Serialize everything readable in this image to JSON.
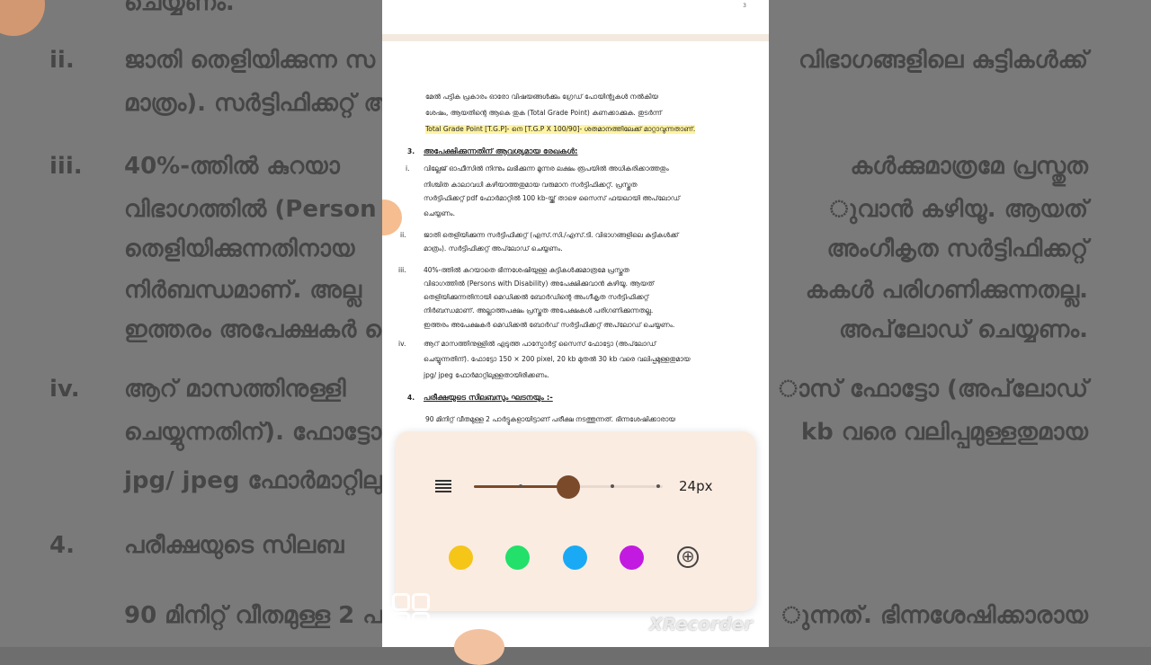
{
  "background": {
    "lines": [
      {
        "num": "ii.",
        "text": "ജാതി തെളിയിക്കുന്ന സ",
        "right": "വിഭാഗങ്ങളിലെ കുട്ടികൾക്ക്"
      },
      {
        "num": "",
        "text": "മാത്രം). സർട്ടിഫിക്കറ്റ് അ",
        "right": ""
      },
      {
        "num": "iii.",
        "text": "40%-ത്തിൽ കുറയാ",
        "right": "കൾക്കുമാത്രമേ പ്രസ്തുത"
      },
      {
        "num": "",
        "text": "വിഭാഗത്തിൽ (Person",
        "right": "ുവാൻ കഴിയൂ. ആയത്"
      },
      {
        "num": "",
        "text": "തെളിയിക്കുന്നതിനായ",
        "right": "അംഗീകൃത സർട്ടിഫിക്കറ്റ്"
      },
      {
        "num": "",
        "text": "നിർബന്ധമാണ്. അല്ല",
        "right": "കകൾ പരിഗണിക്കുന്നതല്ല."
      },
      {
        "num": "",
        "text": "ഇത്തരം അപേക്ഷകർ മെ",
        "right": "അപ്‌ലോഡ് ചെയ്യണം."
      },
      {
        "num": "iv.",
        "text": "ആറ് മാസത്തിനുള്ളി",
        "right": "ാസ് ഫോട്ടോ (അപ്‌ലോഡ്"
      },
      {
        "num": "",
        "text": "ചെയ്യുന്നതിന്). ഫോട്ടോ",
        "right": "kb വരെ വലിപ്പമുള്ളതുമായ"
      },
      {
        "num": "",
        "text": "jpg/ jpeg ഫോർമാറ്റിലു",
        "right": ""
      },
      {
        "num": "4.",
        "text": "പരീക്ഷയുടെ സിലബ",
        "right": ""
      },
      {
        "num": "",
        "text": "90 മിനിറ്റ് വീതമുള്ള 2 പ",
        "right": "ുന്നത്. ഭിന്നശേഷിക്കാരായ"
      }
    ],
    "top_fragment": "ചെയ്യണം."
  },
  "document": {
    "page_number": "3",
    "intro": [
      "മേൽ പട്ടിക പ്രകാരം ഓരോ വിഷയങ്ങൾക്കും ഗ്രേഡ് പോയിന്റുകൾ നൽകിയ",
      "ശേഷം, ആയതിന്റെ ആകെ തുക (Total Grade Point) കണക്കാക്കുക. തുടർന്ന്",
      "Total Grade Point [T.G.P]- നെ [T.G.P X 100/90]- ശതമാനത്തിലേക്ക് മാറ്റാവുന്നതാണ്."
    ],
    "section3": {
      "num": "3.",
      "title": "അപേക്ഷിക്കുന്നതിന് ആവശ്യമായ രേഖകൾ:"
    },
    "items": [
      {
        "num": "i.",
        "lines": [
          "വില്ലേജ് ഓഫീസിൽ നിന്നും ലഭിക്കുന്ന മൂന്നര ലക്ഷം രൂപയിൽ അധികരിക്കാത്തതും",
          "നിശ്ചിത കാലാവധി കഴിയാത്തതുമായ വരുമാന സർട്ടിഫിക്കറ്റ്. പ്രസ്തുത",
          "സർട്ടിഫിക്കറ്റ് pdf ഫോർമാറ്റിൽ 100 kb-യ്ക്ക് താഴെ സൈസ് ഫയലായി അപ്‌ലോഡ്",
          "ചെയ്യണം."
        ]
      },
      {
        "num": "ii.",
        "lines": [
          "ജാതി തെളിയിക്കുന്ന സർട്ടിഫിക്കറ്റ് (എസ്.സി./എസ്.ടി. വിഭാഗങ്ങളിലെ കുട്ടികൾക്ക്",
          "മാത്രം). സർട്ടിഫിക്കറ്റ് അപ്‌ലോഡ് ചെയ്യണം."
        ]
      },
      {
        "num": "iii.",
        "lines": [
          "40%-ത്തിൽ കുറയാതെ ഭിന്നശേഷിയുള്ള കുട്ടികൾക്കുമാത്രമേ പ്രസ്തുത",
          "വിഭാഗത്തിൽ (Persons with Disability) അപേക്ഷിക്കുവാൻ കഴിയൂ. ആയത്",
          "തെളിയിക്കുന്നതിനായി മെഡിക്കൽ ബോർഡിന്റെ അംഗീകൃത സർട്ടിഫിക്കറ്റ്",
          "നിർബന്ധമാണ്. അല്ലാത്തപക്ഷം പ്രസ്തുത അപേക്ഷകൾ പരിഗണിക്കുന്നതല്ല.",
          "ഇത്തരം അപേക്ഷകർ മെഡിക്കൽ ബോർഡ് സർട്ടിഫിക്കറ്റ് അപ്‌ലോഡ് ചെയ്യണം."
        ]
      },
      {
        "num": "iv.",
        "lines": [
          "ആറ് മാസത്തിനുള്ളിൽ എടുത്ത പാസ്പോർട്ട് സൈസ് ഫോട്ടോ (അപ്‌ലോഡ്",
          "ചെയ്യുന്നതിന്). ഫോട്ടോ 150 × 200 pixel, 20 kb മുതൽ 30 kb വരെ വലിപ്പമുള്ളതുമായ",
          "jpg/ jpeg ഫോർമാറ്റിലുള്ളതായിരിക്കണം."
        ]
      }
    ],
    "section4": {
      "num": "4.",
      "title": "പരീക്ഷയുടെ സിലബസും ഘടനയും :-"
    },
    "tail": "90 മിനിറ്റ് വീതമുള്ള 2 പാർട്ടുകളായിട്ടാണ് പരീക്ഷ നടത്തുന്നത്. ഭിന്നശേഷിക്കാരായ"
  },
  "pen_panel": {
    "size_label": "24px",
    "size_value_fraction": 0.5,
    "colors": [
      "#f5c518",
      "#22e06a",
      "#1aaaf5",
      "#c21ae0"
    ],
    "add_color_glyph": "⊕"
  },
  "watermark": "XRecorder",
  "icons": [
    "stroke-width-icon",
    "add-color-icon",
    "apps-grid-icon"
  ]
}
